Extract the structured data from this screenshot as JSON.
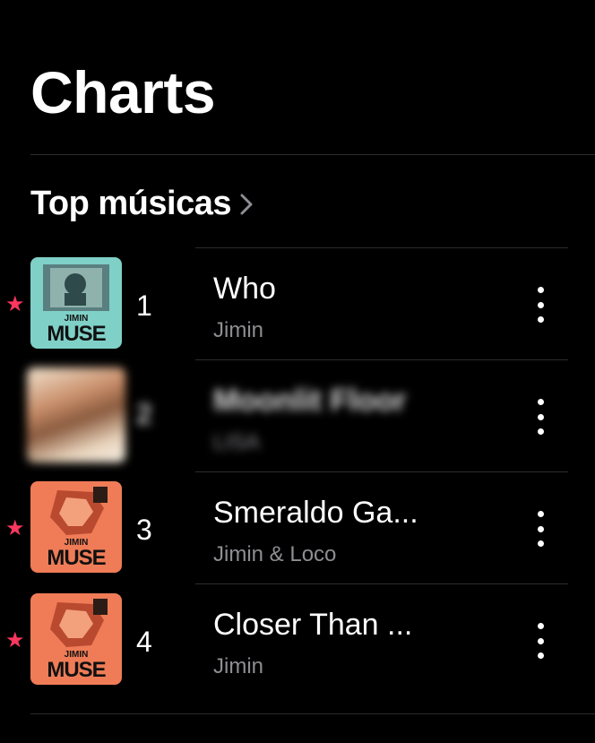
{
  "page": {
    "title": "Charts"
  },
  "section": {
    "title": "Top músicas"
  },
  "tracks": [
    {
      "rank": "1",
      "title": "Who",
      "artist": "Jimin",
      "starred": true,
      "art_label_1": "JIMIN",
      "art_label_2": "MUSE",
      "art_color": "#7fd0c7"
    },
    {
      "rank": "2",
      "title": "Moonlit Floor",
      "artist": "LISA",
      "starred": false,
      "blurred": true,
      "art_color": "#e6d2b8"
    },
    {
      "rank": "3",
      "title": "Smeraldo Ga...",
      "artist": "Jimin & Loco",
      "starred": true,
      "art_label_1": "JIMIN",
      "art_label_2": "MUSE",
      "art_color": "#ef7c57"
    },
    {
      "rank": "4",
      "title": "Closer Than ...",
      "artist": "Jimin",
      "starred": true,
      "art_label_1": "JIMIN",
      "art_label_2": "MUSE",
      "art_color": "#ef7c57"
    }
  ],
  "icons": {
    "star": "★",
    "chevron": "chevron-right-icon",
    "more": "more-vertical-icon"
  },
  "colors": {
    "background": "#000000",
    "star": "#ff375f",
    "secondary_text": "#8e8e93",
    "divider": "#2c2c2e"
  }
}
